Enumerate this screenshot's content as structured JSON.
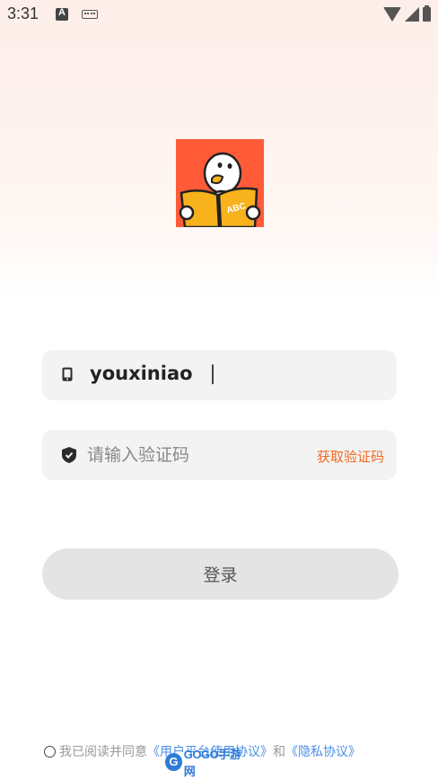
{
  "status_bar": {
    "time": "3:31",
    "icons": [
      "a-notification-icon",
      "keyboard-icon",
      "wifi-icon",
      "signal-icon",
      "battery-icon"
    ]
  },
  "logo": {
    "icon": "duck-reading-book-logo",
    "book_text": "ABC",
    "bg_color": "#ff5b38"
  },
  "phone_field": {
    "icon": "phone-icon",
    "value": "youxiniao"
  },
  "code_field": {
    "icon": "shield-check-icon",
    "placeholder": "请输入验证码",
    "get_code_label": "获取验证码",
    "accent_color": "#f06a22"
  },
  "login_button": {
    "label": "登录"
  },
  "agreement": {
    "prefix": "我已阅读并同意",
    "user_agreement": "《用户平台使用协议》",
    "conjunction": "和",
    "privacy_policy": "《隐私协议》",
    "link_color": "#4a8fe8"
  },
  "watermark": {
    "logo_letter": "G",
    "text": "GOGO手游网"
  }
}
